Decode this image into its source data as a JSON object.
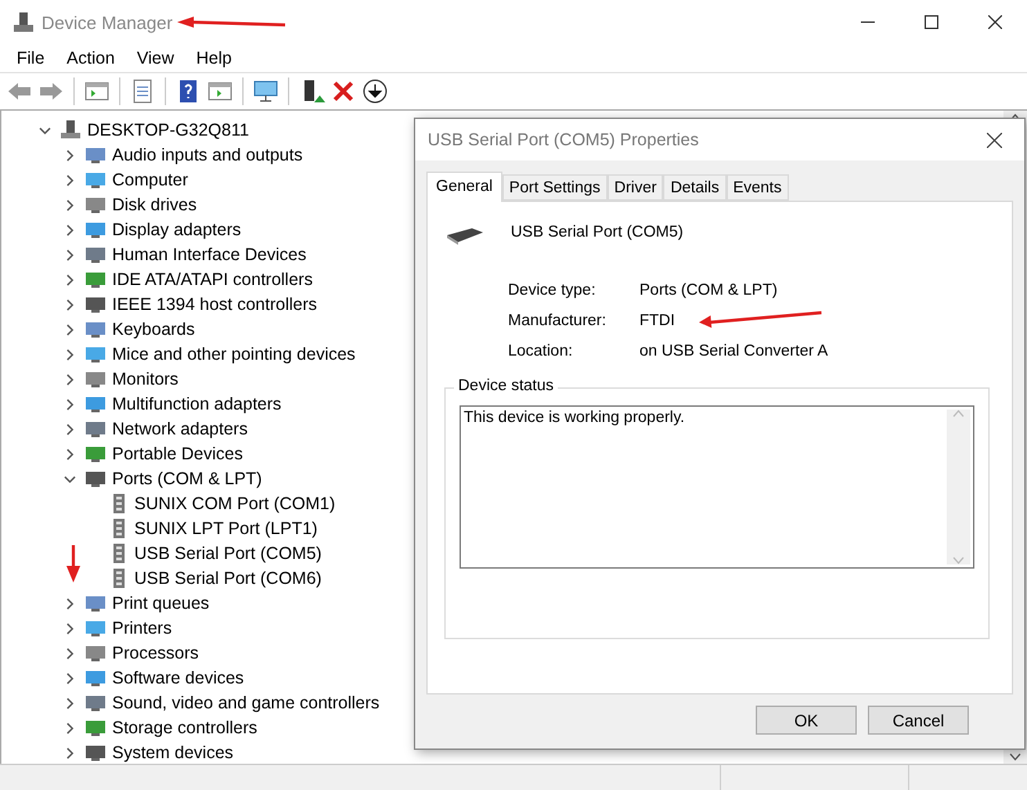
{
  "window": {
    "title": "Device Manager"
  },
  "menu": [
    "File",
    "Action",
    "View",
    "Help"
  ],
  "tree": {
    "label": "DESKTOP-G32Q811",
    "expanded": true,
    "children": [
      {
        "label": "Audio inputs and outputs",
        "expanded": false
      },
      {
        "label": "Computer",
        "expanded": false
      },
      {
        "label": "Disk drives",
        "expanded": false
      },
      {
        "label": "Display adapters",
        "expanded": false
      },
      {
        "label": "Human Interface Devices",
        "expanded": false
      },
      {
        "label": "IDE ATA/ATAPI controllers",
        "expanded": false
      },
      {
        "label": "IEEE 1394 host controllers",
        "expanded": false
      },
      {
        "label": "Keyboards",
        "expanded": false
      },
      {
        "label": "Mice and other pointing devices",
        "expanded": false
      },
      {
        "label": "Monitors",
        "expanded": false
      },
      {
        "label": "Multifunction adapters",
        "expanded": false
      },
      {
        "label": "Network adapters",
        "expanded": false
      },
      {
        "label": "Portable Devices",
        "expanded": false
      },
      {
        "label": "Ports (COM & LPT)",
        "expanded": true,
        "children": [
          {
            "label": "SUNIX COM Port (COM1)"
          },
          {
            "label": "SUNIX LPT Port (LPT1)"
          },
          {
            "label": "USB Serial Port (COM5)"
          },
          {
            "label": "USB Serial Port (COM6)"
          }
        ]
      },
      {
        "label": "Print queues",
        "expanded": false
      },
      {
        "label": "Printers",
        "expanded": false
      },
      {
        "label": "Processors",
        "expanded": false
      },
      {
        "label": "Software devices",
        "expanded": false
      },
      {
        "label": "Sound, video and game controllers",
        "expanded": false
      },
      {
        "label": "Storage controllers",
        "expanded": false
      },
      {
        "label": "System devices",
        "expanded": false
      }
    ]
  },
  "dialog": {
    "title": "USB Serial Port (COM5) Properties",
    "tabs": [
      {
        "label": "General",
        "selected": true
      },
      {
        "label": "Port Settings",
        "selected": false
      },
      {
        "label": "Driver",
        "selected": false
      },
      {
        "label": "Details",
        "selected": false
      },
      {
        "label": "Events",
        "selected": false
      }
    ],
    "device_name": "USB Serial Port (COM5)",
    "properties": [
      {
        "label": "Device type:",
        "value": "Ports (COM & LPT)"
      },
      {
        "label": "Manufacturer:",
        "value": "FTDI"
      },
      {
        "label": "Location:",
        "value": "on USB Serial Converter A"
      }
    ],
    "status_group": {
      "title": "Device status",
      "text": "This device is working properly."
    },
    "buttons": [
      "OK",
      "Cancel"
    ]
  }
}
